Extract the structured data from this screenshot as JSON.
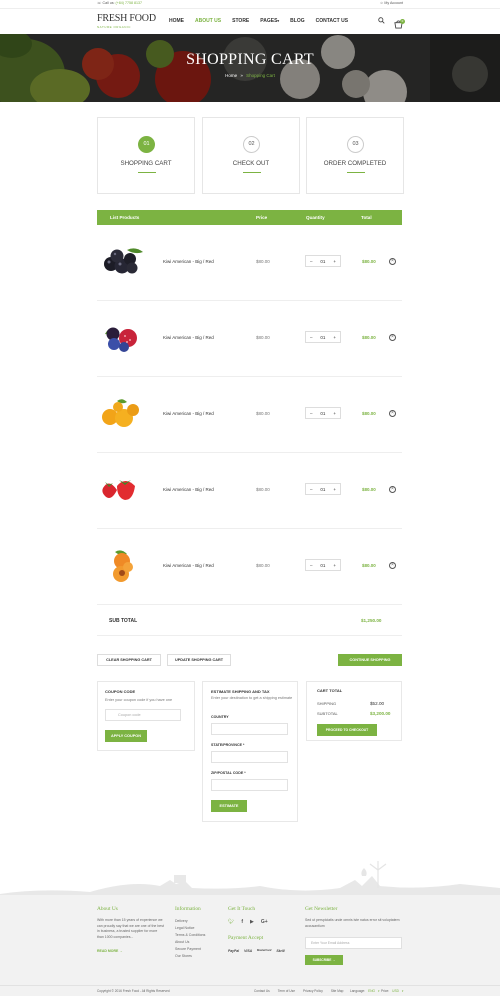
{
  "topbar": {
    "call_label": "Call us:",
    "phone": "(+84) 7758 8137",
    "account": "My Account"
  },
  "header": {
    "logo": "FRESH FOOD",
    "tagline": "NATURE ORGANIC",
    "nav": [
      "HOME",
      "ABOUT US",
      "STORE",
      "PAGES",
      "BLOG",
      "CONTACT US"
    ],
    "active_nav": "ABOUT US",
    "cart_count": "0"
  },
  "banner": {
    "title": "SHOPPING CART",
    "crumb_home": "Home",
    "crumb_sep": "»",
    "crumb_current": "Shopping Cart"
  },
  "steps": [
    {
      "num": "01",
      "label": "SHOPPING CART",
      "active": true
    },
    {
      "num": "02",
      "label": "CHECK OUT",
      "active": false
    },
    {
      "num": "03",
      "label": "ORDER COMPLETED",
      "active": false
    }
  ],
  "table": {
    "headers": {
      "products": "List Products",
      "price": "Price",
      "quantity": "Quantity",
      "total": "Total"
    },
    "rows": [
      {
        "image": "blackcurrant",
        "name": "Kiwi American - Big / Red",
        "price": "$80.00",
        "qty": "01",
        "total": "$80.00"
      },
      {
        "image": "mixed-berries",
        "name": "Kiwi American - Big / Red",
        "price": "$80.00",
        "qty": "01",
        "total": "$80.00"
      },
      {
        "image": "apricots",
        "name": "Kiwi American - Big / Red",
        "price": "$80.00",
        "qty": "01",
        "total": "$80.00"
      },
      {
        "image": "strawberries",
        "name": "Kiwi American - Big / Red",
        "price": "$80.00",
        "qty": "01",
        "total": "$80.00"
      },
      {
        "image": "peaches",
        "name": "Kiwi American - Big / Red",
        "price": "$80.00",
        "qty": "01",
        "total": "$80.00"
      }
    ],
    "subtotal_label": "SUB TOTAL",
    "subtotal_value": "$1,250.00"
  },
  "buttons": {
    "clear": "CLEAR SHOPPING CART",
    "update": "UPDATE SHOPPING CART",
    "continue": "CONTINUE SHOPPING"
  },
  "coupon": {
    "title": "COUPON CODE",
    "text": "Enter your coupon code if you have one",
    "placeholder": "Coupon code",
    "button": "APPLY COUPON"
  },
  "estimate": {
    "title": "ESTIMATE SHIPPING AND TAX",
    "text": "Enter your destination to get a shipping estimate",
    "country_label": "COUNTRY",
    "state_label": "STATE/PROVINCE *",
    "zip_label": "ZIP/POSTAL CODE *",
    "button": "ESTIMATE"
  },
  "carttotal": {
    "title": "CART TOTAL",
    "shipping_label": "SHIPPING",
    "shipping_value": "$52.00",
    "subtotal_label": "SUBTOTAL",
    "subtotal_value": "$3,200.00",
    "button": "PROCEED TO CHECKOUT"
  },
  "footer": {
    "about_title": "About Us",
    "about_text": "With more than 15 years of experience we can proudly say that we are one of the best in business, a trusted supplier for more than 1000 companies...",
    "read_more": "READ MORE",
    "info_title": "Information",
    "info_links": [
      "Delivery",
      "Legal Notice",
      "Terms & Conditions",
      "About Us",
      "Secure Payment",
      "Our Stores"
    ],
    "touch_title": "Get It Touch",
    "payment_title": "Payment Accept",
    "payments": [
      "PayPal",
      "VISA",
      "MasterCard",
      "Skrill"
    ],
    "news_title": "Get Newsletter",
    "news_text": "Sed ut perspiciatis unde omnis iste natus error sit voluptatem accusantium",
    "news_placeholder": "Enter Your Email Address",
    "subscribe": "SUBSCRIBE",
    "copyright": "Copyright © 2016 Fresh Food - All Rights Reserved",
    "bottom_links": [
      "Contact Us",
      "Term of Use",
      "Privacy Policy",
      "Site Map"
    ],
    "language_label": "Language:",
    "language_value": "ENG",
    "price_label": "Price:",
    "price_value": "USD"
  },
  "colors": {
    "accent": "#7cb342",
    "banner": "#2f2f2f",
    "footer": "#f2f2f2"
  }
}
